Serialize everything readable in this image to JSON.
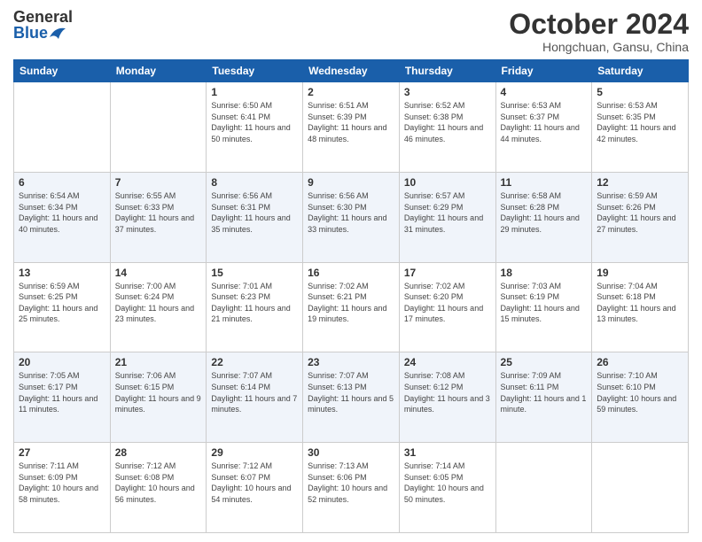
{
  "header": {
    "logo_general": "General",
    "logo_blue": "Blue",
    "month": "October 2024",
    "location": "Hongchuan, Gansu, China"
  },
  "days_of_week": [
    "Sunday",
    "Monday",
    "Tuesday",
    "Wednesday",
    "Thursday",
    "Friday",
    "Saturday"
  ],
  "weeks": [
    [
      {
        "day": "",
        "info": ""
      },
      {
        "day": "",
        "info": ""
      },
      {
        "day": "1",
        "sunrise": "6:50 AM",
        "sunset": "6:41 PM",
        "daylight": "11 hours and 50 minutes."
      },
      {
        "day": "2",
        "sunrise": "6:51 AM",
        "sunset": "6:39 PM",
        "daylight": "11 hours and 48 minutes."
      },
      {
        "day": "3",
        "sunrise": "6:52 AM",
        "sunset": "6:38 PM",
        "daylight": "11 hours and 46 minutes."
      },
      {
        "day": "4",
        "sunrise": "6:53 AM",
        "sunset": "6:37 PM",
        "daylight": "11 hours and 44 minutes."
      },
      {
        "day": "5",
        "sunrise": "6:53 AM",
        "sunset": "6:35 PM",
        "daylight": "11 hours and 42 minutes."
      }
    ],
    [
      {
        "day": "6",
        "sunrise": "6:54 AM",
        "sunset": "6:34 PM",
        "daylight": "11 hours and 40 minutes."
      },
      {
        "day": "7",
        "sunrise": "6:55 AM",
        "sunset": "6:33 PM",
        "daylight": "11 hours and 37 minutes."
      },
      {
        "day": "8",
        "sunrise": "6:56 AM",
        "sunset": "6:31 PM",
        "daylight": "11 hours and 35 minutes."
      },
      {
        "day": "9",
        "sunrise": "6:56 AM",
        "sunset": "6:30 PM",
        "daylight": "11 hours and 33 minutes."
      },
      {
        "day": "10",
        "sunrise": "6:57 AM",
        "sunset": "6:29 PM",
        "daylight": "11 hours and 31 minutes."
      },
      {
        "day": "11",
        "sunrise": "6:58 AM",
        "sunset": "6:28 PM",
        "daylight": "11 hours and 29 minutes."
      },
      {
        "day": "12",
        "sunrise": "6:59 AM",
        "sunset": "6:26 PM",
        "daylight": "11 hours and 27 minutes."
      }
    ],
    [
      {
        "day": "13",
        "sunrise": "6:59 AM",
        "sunset": "6:25 PM",
        "daylight": "11 hours and 25 minutes."
      },
      {
        "day": "14",
        "sunrise": "7:00 AM",
        "sunset": "6:24 PM",
        "daylight": "11 hours and 23 minutes."
      },
      {
        "day": "15",
        "sunrise": "7:01 AM",
        "sunset": "6:23 PM",
        "daylight": "11 hours and 21 minutes."
      },
      {
        "day": "16",
        "sunrise": "7:02 AM",
        "sunset": "6:21 PM",
        "daylight": "11 hours and 19 minutes."
      },
      {
        "day": "17",
        "sunrise": "7:02 AM",
        "sunset": "6:20 PM",
        "daylight": "11 hours and 17 minutes."
      },
      {
        "day": "18",
        "sunrise": "7:03 AM",
        "sunset": "6:19 PM",
        "daylight": "11 hours and 15 minutes."
      },
      {
        "day": "19",
        "sunrise": "7:04 AM",
        "sunset": "6:18 PM",
        "daylight": "11 hours and 13 minutes."
      }
    ],
    [
      {
        "day": "20",
        "sunrise": "7:05 AM",
        "sunset": "6:17 PM",
        "daylight": "11 hours and 11 minutes."
      },
      {
        "day": "21",
        "sunrise": "7:06 AM",
        "sunset": "6:15 PM",
        "daylight": "11 hours and 9 minutes."
      },
      {
        "day": "22",
        "sunrise": "7:07 AM",
        "sunset": "6:14 PM",
        "daylight": "11 hours and 7 minutes."
      },
      {
        "day": "23",
        "sunrise": "7:07 AM",
        "sunset": "6:13 PM",
        "daylight": "11 hours and 5 minutes."
      },
      {
        "day": "24",
        "sunrise": "7:08 AM",
        "sunset": "6:12 PM",
        "daylight": "11 hours and 3 minutes."
      },
      {
        "day": "25",
        "sunrise": "7:09 AM",
        "sunset": "6:11 PM",
        "daylight": "11 hours and 1 minute."
      },
      {
        "day": "26",
        "sunrise": "7:10 AM",
        "sunset": "6:10 PM",
        "daylight": "10 hours and 59 minutes."
      }
    ],
    [
      {
        "day": "27",
        "sunrise": "7:11 AM",
        "sunset": "6:09 PM",
        "daylight": "10 hours and 58 minutes."
      },
      {
        "day": "28",
        "sunrise": "7:12 AM",
        "sunset": "6:08 PM",
        "daylight": "10 hours and 56 minutes."
      },
      {
        "day": "29",
        "sunrise": "7:12 AM",
        "sunset": "6:07 PM",
        "daylight": "10 hours and 54 minutes."
      },
      {
        "day": "30",
        "sunrise": "7:13 AM",
        "sunset": "6:06 PM",
        "daylight": "10 hours and 52 minutes."
      },
      {
        "day": "31",
        "sunrise": "7:14 AM",
        "sunset": "6:05 PM",
        "daylight": "10 hours and 50 minutes."
      },
      {
        "day": "",
        "info": ""
      },
      {
        "day": "",
        "info": ""
      }
    ]
  ]
}
